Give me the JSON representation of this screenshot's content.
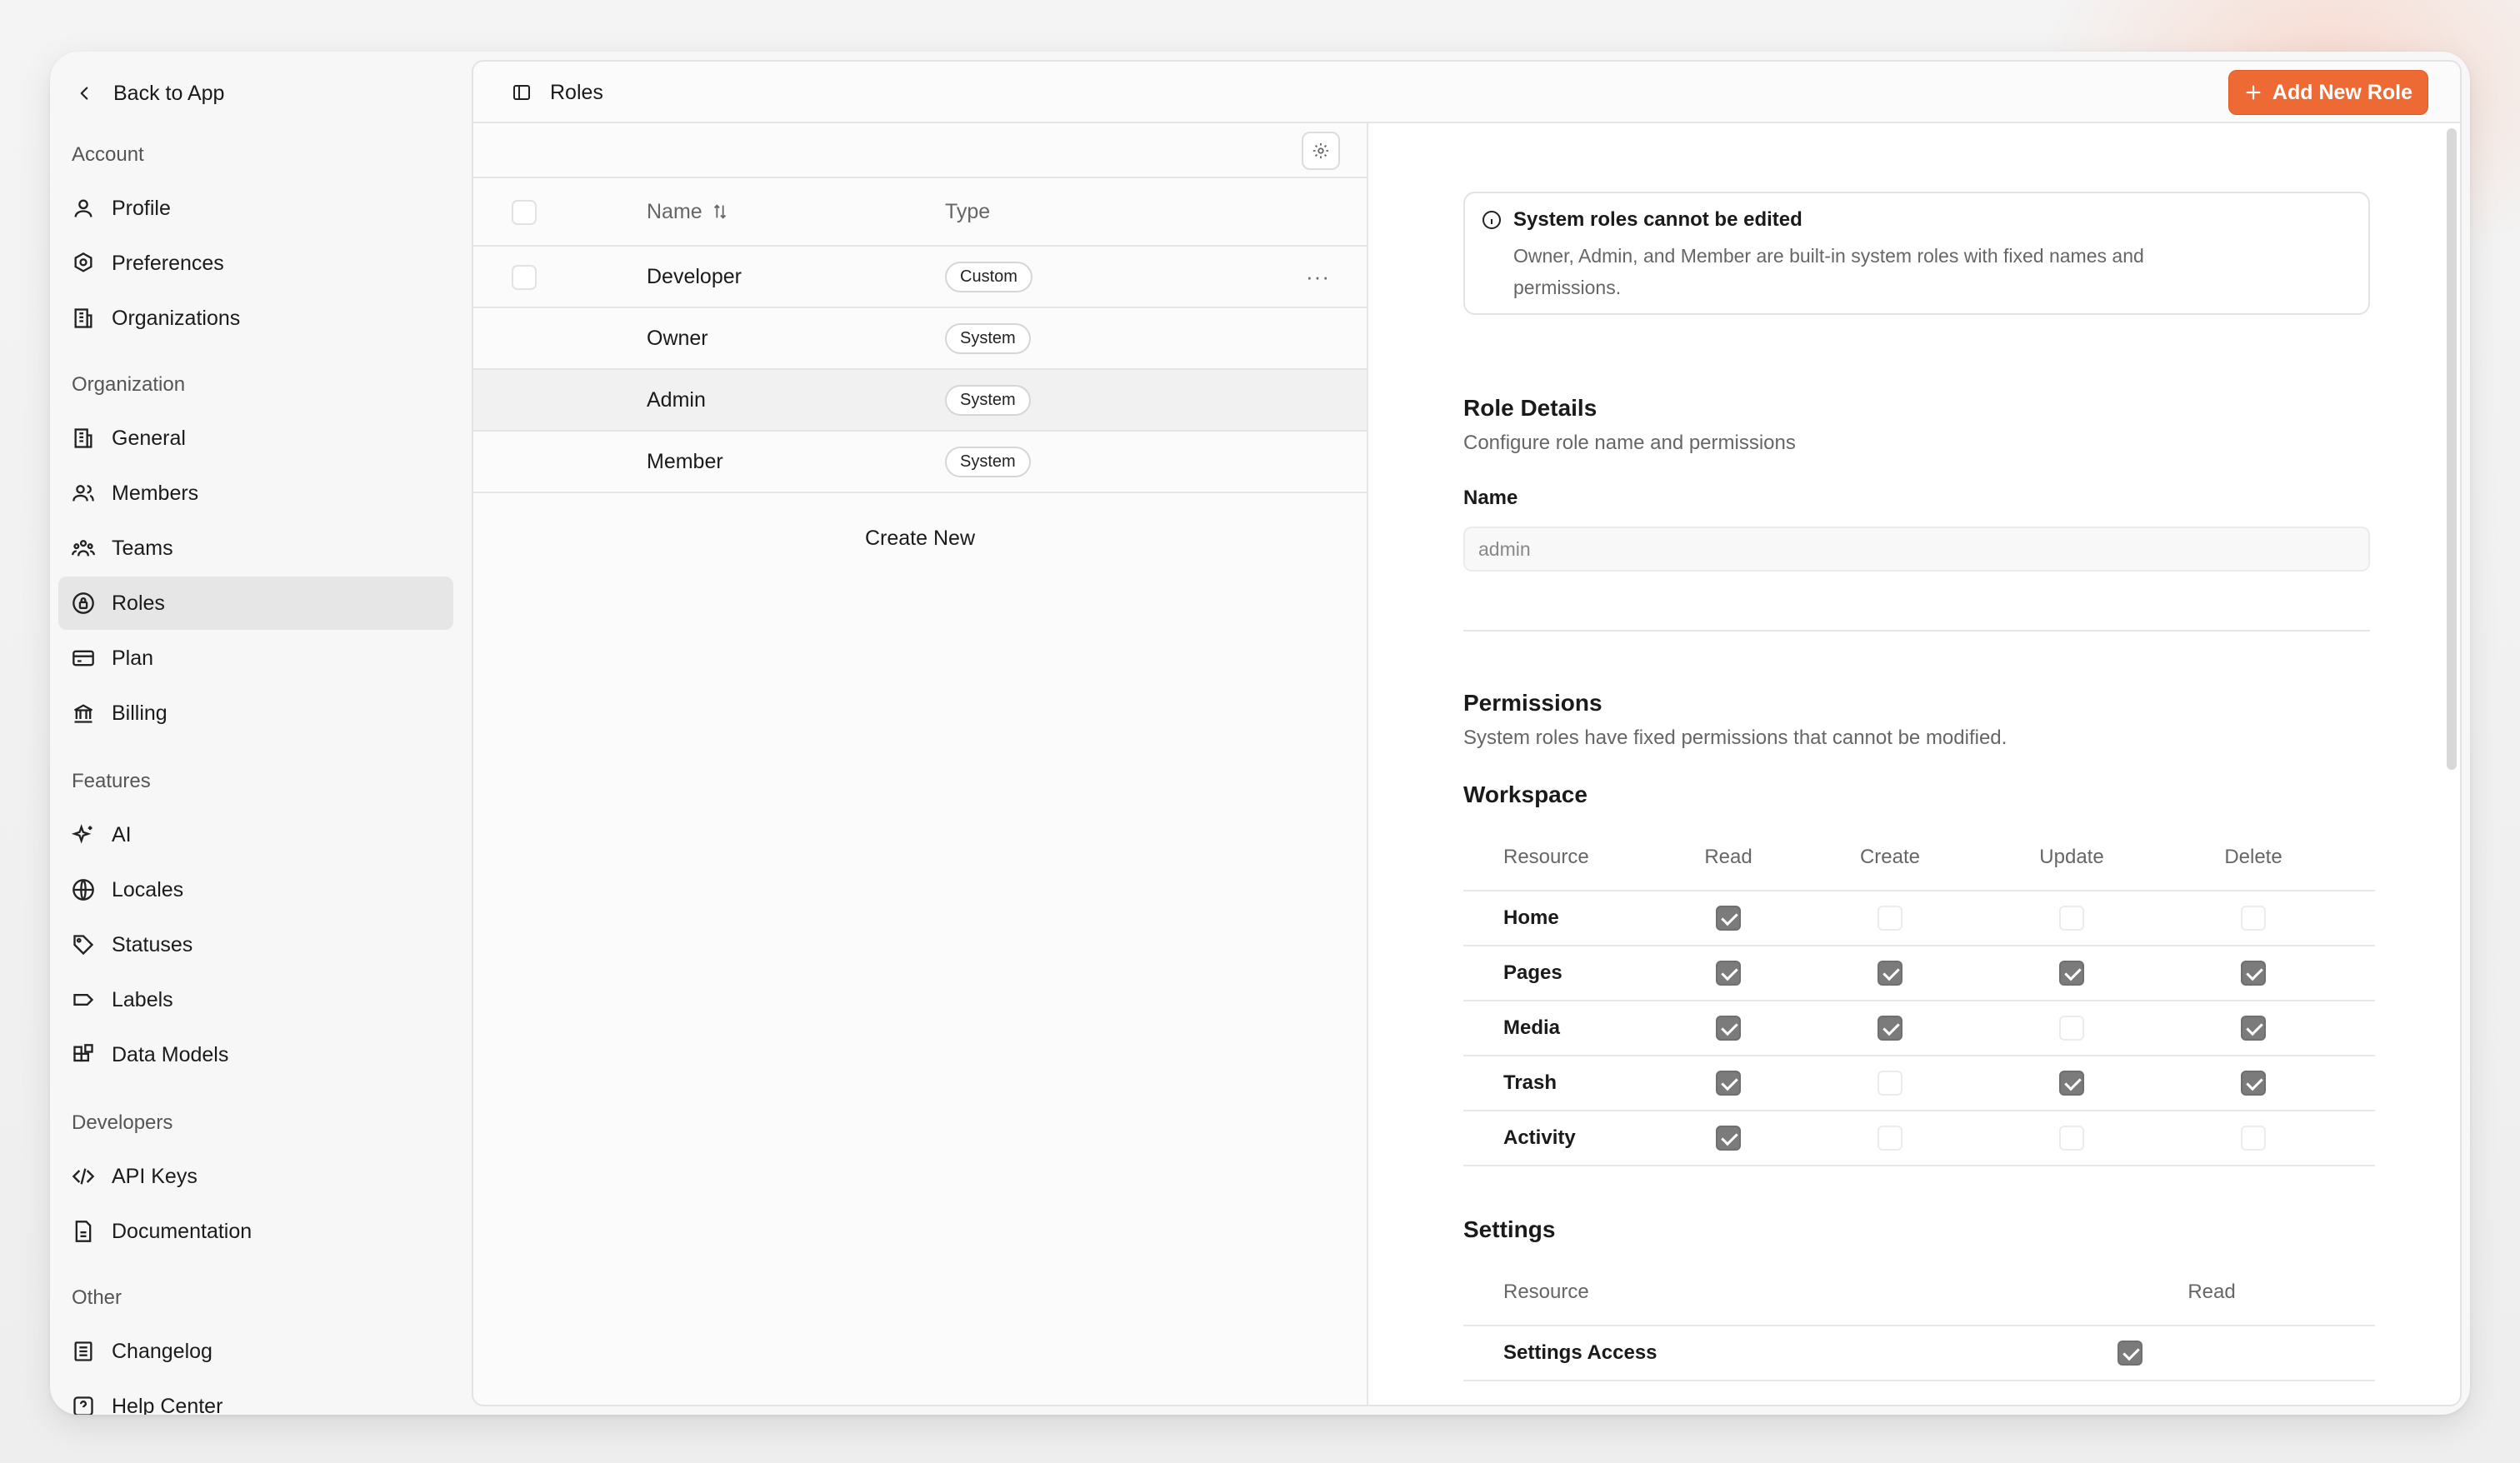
{
  "sidebar": {
    "back_label": "Back to App",
    "sections": [
      {
        "title": "Account",
        "items": [
          {
            "label": "Profile",
            "icon": "user-icon"
          },
          {
            "label": "Preferences",
            "icon": "gear-icon"
          },
          {
            "label": "Organizations",
            "icon": "building-icon"
          }
        ]
      },
      {
        "title": "Organization",
        "items": [
          {
            "label": "General",
            "icon": "building-icon"
          },
          {
            "label": "Members",
            "icon": "users-icon"
          },
          {
            "label": "Teams",
            "icon": "team-icon"
          },
          {
            "label": "Roles",
            "icon": "lock-icon"
          },
          {
            "label": "Plan",
            "icon": "card-icon"
          },
          {
            "label": "Billing",
            "icon": "bank-icon"
          }
        ]
      },
      {
        "title": "Features",
        "items": [
          {
            "label": "AI",
            "icon": "sparkles-icon"
          },
          {
            "label": "Locales",
            "icon": "globe-icon"
          },
          {
            "label": "Statuses",
            "icon": "tag-icon"
          },
          {
            "label": "Labels",
            "icon": "label-icon"
          },
          {
            "label": "Data Models",
            "icon": "blocks-icon"
          }
        ]
      },
      {
        "title": "Developers",
        "items": [
          {
            "label": "API Keys",
            "icon": "code-icon"
          },
          {
            "label": "Documentation",
            "icon": "file-icon"
          }
        ]
      },
      {
        "title": "Other",
        "items": [
          {
            "label": "Changelog",
            "icon": "list-icon"
          },
          {
            "label": "Help Center",
            "icon": "help-icon"
          }
        ]
      }
    ],
    "active_item": "Roles"
  },
  "header": {
    "title": "Roles",
    "add_button": "Add New Role",
    "accent": "#ee6a35"
  },
  "roles_table": {
    "columns": {
      "name": "Name",
      "type": "Type"
    },
    "rows": [
      {
        "name": "Developer",
        "type": "Custom"
      },
      {
        "name": "Owner",
        "type": "System"
      },
      {
        "name": "Admin",
        "type": "System"
      },
      {
        "name": "Member",
        "type": "System"
      }
    ],
    "create_new": "Create New"
  },
  "detail": {
    "notice_title": "System roles cannot be edited",
    "notice_text": "Owner, Admin, and Member are built-in system roles with fixed names and permissions.",
    "role_details_title": "Role Details",
    "role_details_sub": "Configure role name and permissions",
    "name_label": "Name",
    "name_placeholder": "admin",
    "permissions_title": "Permissions",
    "permissions_sub": "System roles have fixed permissions that cannot be modified.",
    "workspace": {
      "title": "Workspace",
      "headers": {
        "resource": "Resource",
        "read": "Read",
        "create": "Create",
        "update": "Update",
        "delete": "Delete"
      },
      "rows": [
        {
          "resource": "Home",
          "read": true,
          "create": false,
          "update": false,
          "delete": false
        },
        {
          "resource": "Pages",
          "read": true,
          "create": true,
          "update": true,
          "delete": true
        },
        {
          "resource": "Media",
          "read": true,
          "create": true,
          "update": false,
          "delete": true
        },
        {
          "resource": "Trash",
          "read": true,
          "create": false,
          "update": true,
          "delete": true
        },
        {
          "resource": "Activity",
          "read": true,
          "create": false,
          "update": false,
          "delete": false
        }
      ]
    },
    "settings": {
      "title": "Settings",
      "headers": {
        "resource": "Resource",
        "read": "Read"
      },
      "rows": [
        {
          "resource": "Settings Access",
          "read": true
        }
      ]
    }
  }
}
